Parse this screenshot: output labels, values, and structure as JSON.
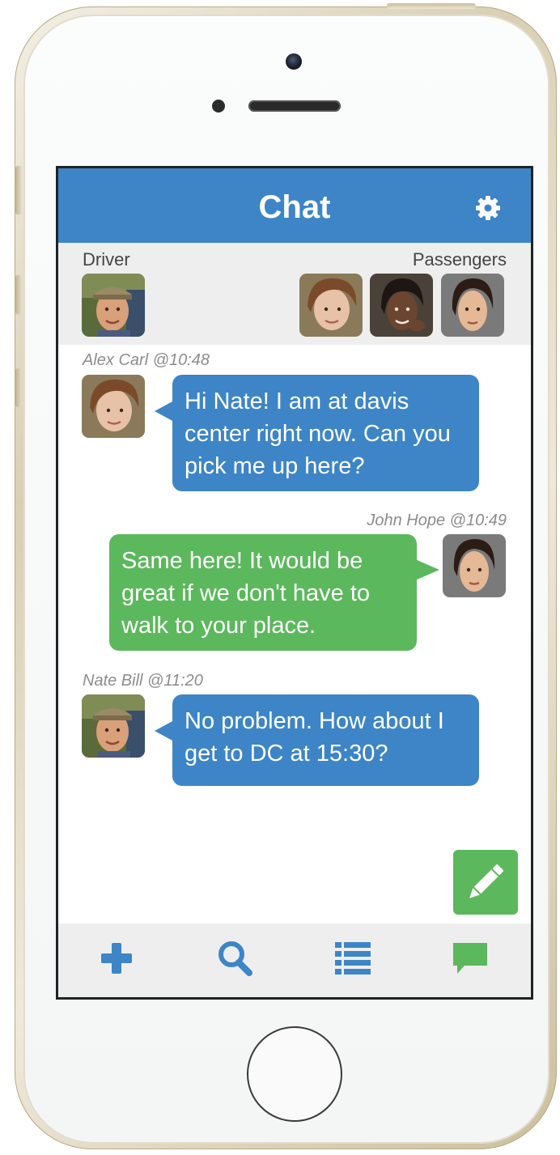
{
  "header": {
    "title": "Chat",
    "settings_icon": "gear-icon"
  },
  "riders": {
    "driver_label": "Driver",
    "passengers_label": "Passengers"
  },
  "messages": [
    {
      "sender_meta": "Alex Carl @10:48",
      "text": "Hi Nate! I am at davis center right now. Can you pick me up here?",
      "side": "left",
      "color": "#3d85c6"
    },
    {
      "sender_meta": "John Hope @10:49",
      "text": "Same here! It would be great if we don't have to walk to your place.",
      "side": "right",
      "color": "#5cb85c"
    },
    {
      "sender_meta": "Nate Bill @11:20",
      "text": "No problem. How about I get to DC at 15:30?",
      "side": "left",
      "color": "#3d85c6"
    }
  ],
  "compose_icon": "pencil-icon",
  "tabbar": {
    "items": [
      {
        "icon": "plus-icon"
      },
      {
        "icon": "search-icon"
      },
      {
        "icon": "list-icon"
      },
      {
        "icon": "chat-bubble-icon"
      }
    ]
  },
  "colors": {
    "accent_blue": "#3d85c6",
    "accent_green": "#5cb85c",
    "panel_gray": "#eeeeee"
  }
}
